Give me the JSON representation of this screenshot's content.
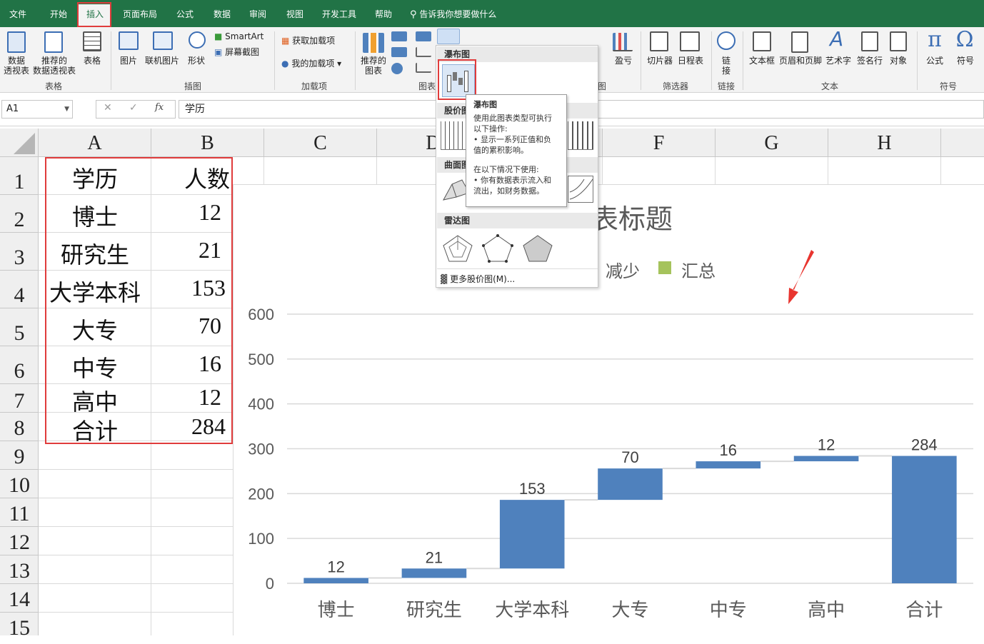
{
  "ribbon_tabs": [
    "文件",
    "开始",
    "插入",
    "页面布局",
    "公式",
    "数据",
    "审阅",
    "视图",
    "开发工具",
    "帮助"
  ],
  "active_tab": "插入",
  "tell_me": "告诉我你想要做什么",
  "ribbon": {
    "table_group": {
      "pivot1": "数据",
      "pivot2": "透视表",
      "rec1": "推荐的",
      "rec2": "数据透视表",
      "table": "表格",
      "label": "表格"
    },
    "illus_group": {
      "pictures": "图片",
      "online": "联机图片",
      "shapes": "形状",
      "smartart": "SmartArt",
      "screenshot": "屏幕截图",
      "label": "插图"
    },
    "addins_group": {
      "get": "获取加载项",
      "my": "我的加载项",
      "label": "加载项"
    },
    "charts_group": {
      "rec1": "推荐的",
      "rec2": "图表",
      "label": "图表",
      "winloss": "盈亏"
    },
    "filter_group": {
      "slicer": "切片器",
      "timeline": "日程表",
      "label": "筛选器"
    },
    "links_group": {
      "link1": "链",
      "link2": "接",
      "label": "链接"
    },
    "text_group": {
      "textbox": "文本框",
      "header": "页眉和页脚",
      "wordart": "艺术字",
      "signature": "签名行",
      "object": "对象",
      "label": "文本"
    },
    "symbols_group": {
      "equation": "公式",
      "symbol": "符号",
      "label": "符号"
    }
  },
  "namebox": "A1",
  "formula_value": "学历",
  "columns": [
    "A",
    "B",
    "C",
    "D",
    "E",
    "F",
    "G",
    "H"
  ],
  "rows": [
    "1",
    "2",
    "3",
    "4",
    "5",
    "6",
    "7",
    "8",
    "9",
    "10",
    "11",
    "12",
    "13",
    "14",
    "15"
  ],
  "table": [
    [
      "学历",
      "人数"
    ],
    [
      "博士",
      "12"
    ],
    [
      "研究生",
      "21"
    ],
    [
      "大学本科",
      "153"
    ],
    [
      "大专",
      "70"
    ],
    [
      "中专",
      "16"
    ],
    [
      "高中",
      "12"
    ],
    [
      "合计",
      "284"
    ]
  ],
  "dropdown": {
    "waterfall_header": "瀑布图",
    "stock_header": "股价图",
    "surface_header": "曲面图",
    "radar_header": "雷达图",
    "more": "更多股价图(M)..."
  },
  "tooltip": {
    "title": "瀑布图",
    "line1": "使用此图表类型可执行",
    "line2": "以下操作:",
    "line3": "• 显示一系列正值和负",
    "line4": "值的累积影响。",
    "line5": "在以下情况下使用:",
    "line6": "• 你有数据表示流入和",
    "line7": "流出，如财务数据。"
  },
  "chart_data": {
    "type": "bar",
    "subtype": "waterfall",
    "title": "图表标题",
    "title_visible": "表标题",
    "legend": [
      {
        "name": "减少",
        "color": "#ed7d31",
        "visible_text": "减少"
      },
      {
        "name": "汇总",
        "color": "#a5c35c"
      }
    ],
    "legend_position": "top",
    "categories": [
      "博士",
      "研究生",
      "大学本科",
      "大专",
      "中专",
      "高中",
      "合计"
    ],
    "values": [
      12,
      21,
      153,
      70,
      16,
      12,
      284
    ],
    "bar_color": "#4f81bd",
    "yticks": [
      "0",
      "100",
      "200",
      "300",
      "400",
      "500",
      "600"
    ],
    "ylim": [
      0,
      600
    ],
    "grid": true
  }
}
